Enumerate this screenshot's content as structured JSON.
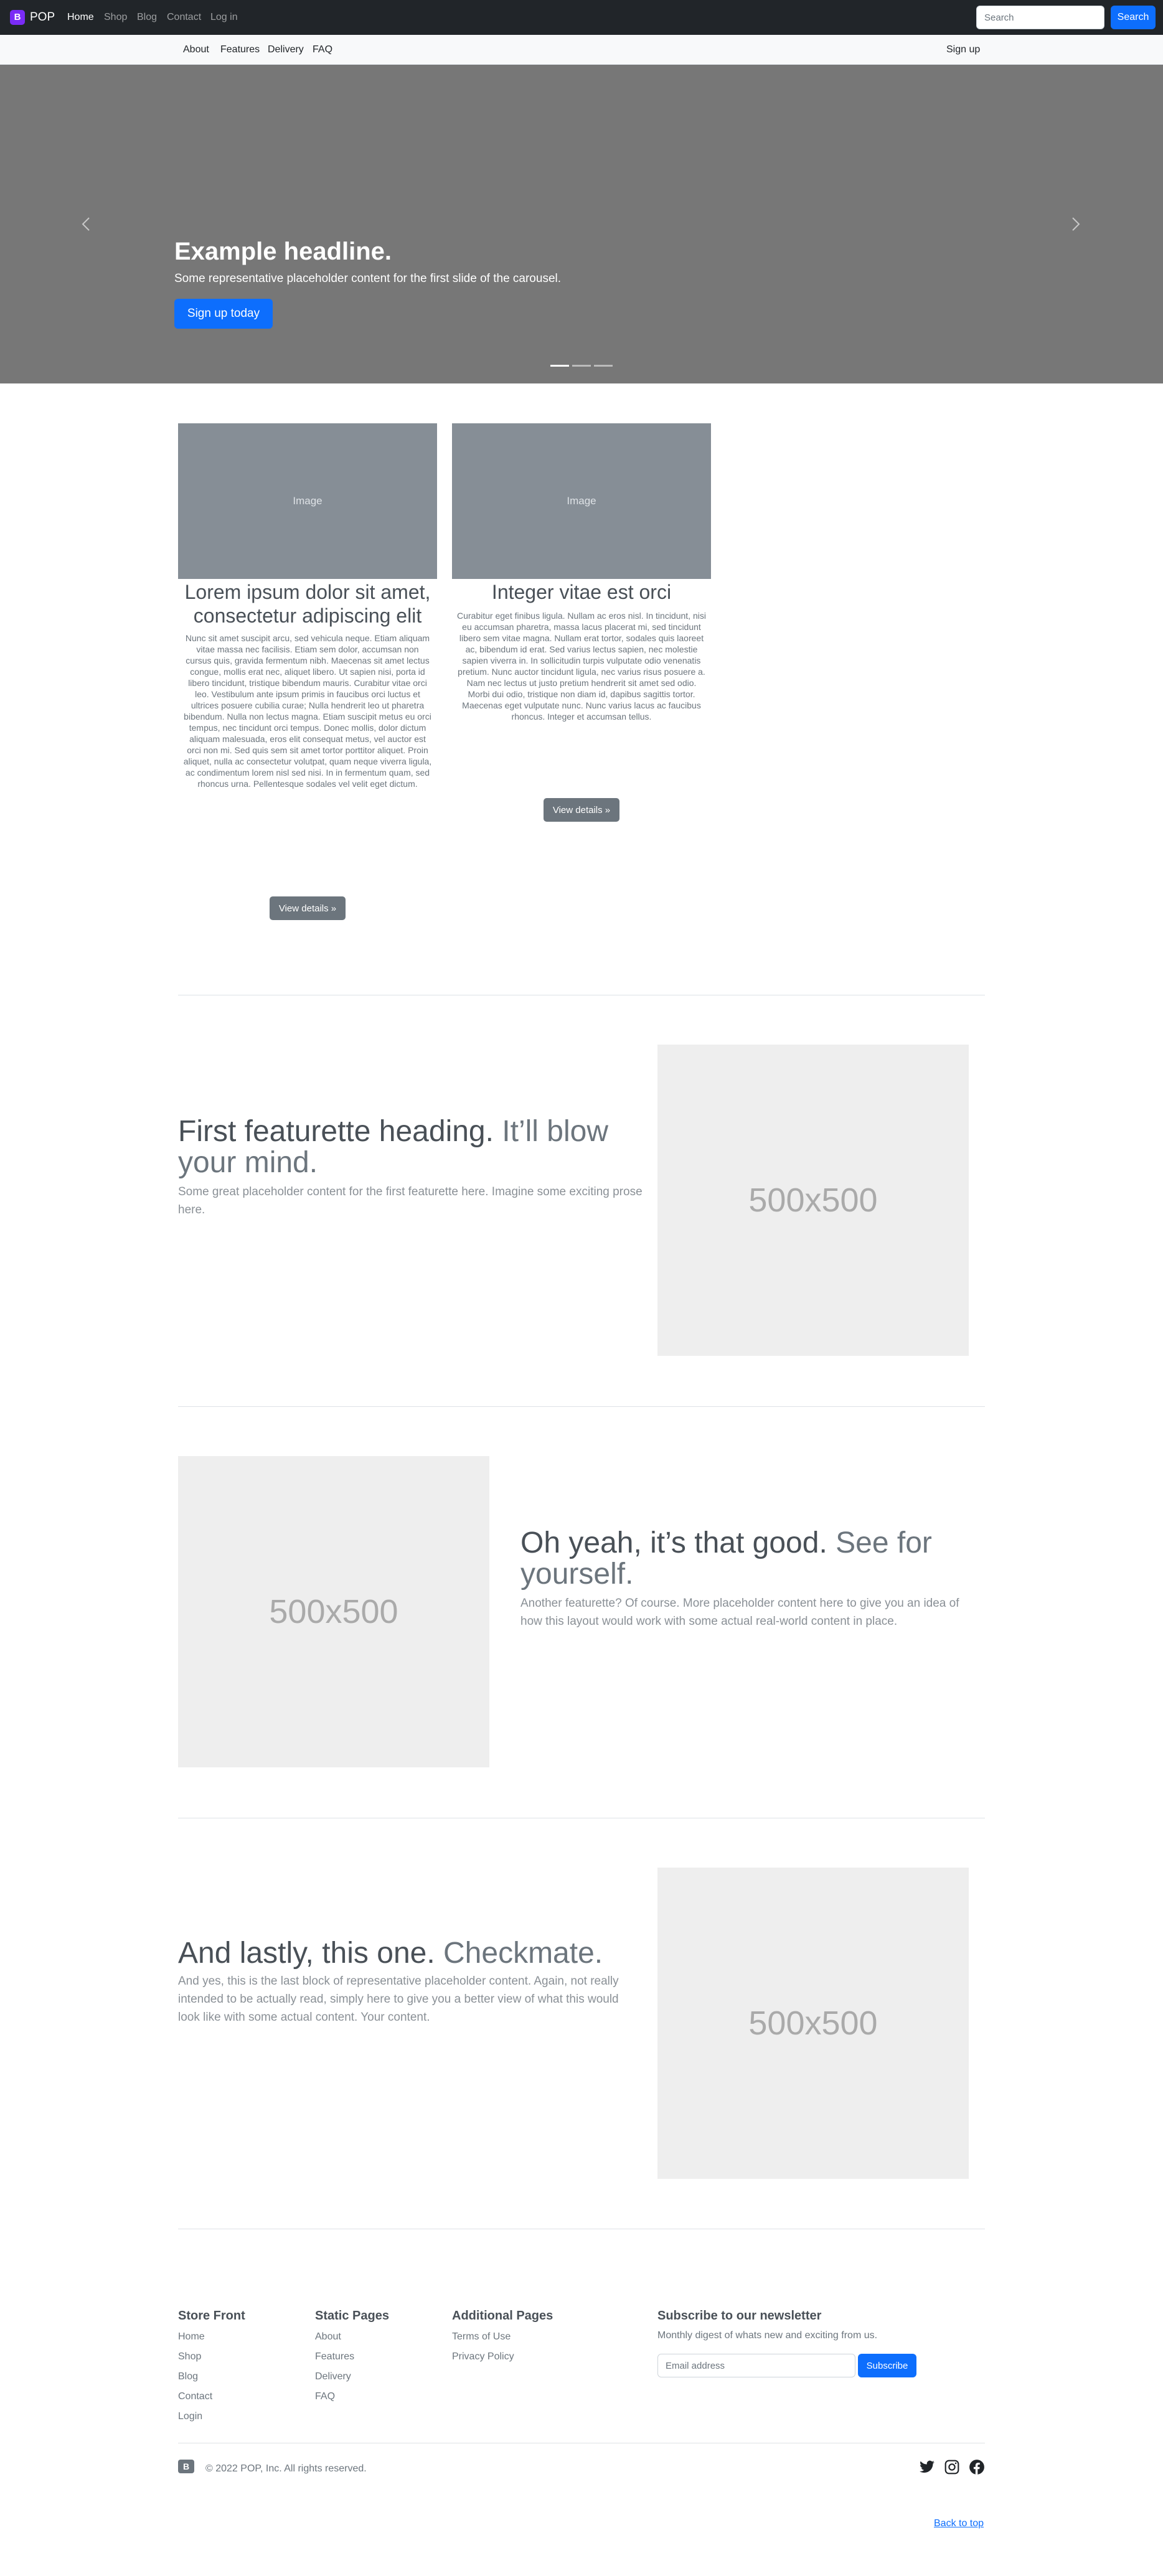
{
  "topnav": {
    "brand": "POP",
    "brand_logo_letter": "B",
    "links": [
      "Home",
      "Shop",
      "Blog",
      "Contact",
      "Log in"
    ],
    "search_placeholder": "Search",
    "search_button": "Search"
  },
  "subnav": {
    "links": [
      "About",
      "Features",
      "Delivery",
      "FAQ"
    ],
    "signup": "Sign up"
  },
  "carousel": {
    "title": "Example headline.",
    "subtitle": "Some representative placeholder content for the first slide of the carousel.",
    "button": "Sign up today",
    "active_slide": 1,
    "slide_count": 3
  },
  "cards": [
    {
      "image_label": "Image",
      "title": "Lorem ipsum dolor sit amet, consectetur adipiscing elit",
      "body": "Nunc sit amet suscipit arcu, sed vehicula neque. Etiam aliquam vitae massa nec facilisis. Etiam sem dolor, accumsan non cursus quis, gravida fermentum nibh. Maecenas sit amet lectus congue, mollis erat nec, aliquet libero. Ut sapien nisi, porta id libero tincidunt, tristique bibendum mauris. Curabitur vitae orci leo. Vestibulum ante ipsum primis in faucibus orci luctus et ultrices posuere cubilia curae; Nulla hendrerit leo ut pharetra bibendum. Nulla non lectus magna. Etiam suscipit metus eu orci tempus, nec tincidunt orci tempus. Donec mollis, dolor dictum aliquam malesuada, eros elit consequat metus, vel auctor est orci non mi. Sed quis sem sit amet tortor porttitor aliquet. Proin aliquet, nulla ac consectetur volutpat, quam neque viverra ligula, ac condimentum lorem nisl sed nisi. In in fermentum quam, sed rhoncus urna. Pellentesque sodales vel velit eget dictum.",
      "button": "View details »"
    },
    {
      "image_label": "Image",
      "title": "Integer vitae est orci",
      "body": "Curabitur eget finibus ligula. Nullam ac eros nisl. In tincidunt, nisi eu accumsan pharetra, massa lacus placerat mi, sed tincidunt libero sem vitae magna. Nullam erat tortor, sodales quis laoreet ac, bibendum id erat. Sed varius lectus sapien, nec molestie sapien viverra in. In sollicitudin turpis vulputate odio venenatis pretium. Nunc auctor tincidunt ligula, nec varius risus posuere a. Nam nec lectus ut justo pretium hendrerit sit amet sed odio. Morbi dui odio, tristique non diam id, dapibus sagittis tortor. Maecenas eget vulputate nunc. Nunc varius lacus ac faucibus rhoncus. Integer et accumsan tellus.",
      "button": "View details »"
    }
  ],
  "featurettes": [
    {
      "heading": "First featurette heading.",
      "heading_muted": "It’ll blow your mind.",
      "lead": "Some great placeholder content for the first featurette here. Imagine some exciting prose here.",
      "placeholder": "500x500"
    },
    {
      "heading": "Oh yeah, it’s that good.",
      "heading_muted": "See for yourself.",
      "lead": "Another featurette? Of course. More placeholder content here to give you an idea of how this layout would work with some actual real-world content in place.",
      "placeholder": "500x500"
    },
    {
      "heading": "And lastly, this one.",
      "heading_muted": "Checkmate.",
      "lead": "And yes, this is the last block of representative placeholder content. Again, not really intended to be actually read, simply here to give you a better view of what this would look like with some actual content. Your content.",
      "placeholder": "500x500"
    }
  ],
  "footer": {
    "columns": [
      {
        "heading": "Store Front",
        "links": [
          "Home",
          "Shop",
          "Blog",
          "Contact",
          "Login"
        ]
      },
      {
        "heading": "Static Pages",
        "links": [
          "About",
          "Features",
          "Delivery",
          "FAQ"
        ]
      },
      {
        "heading": "Additional Pages",
        "links": [
          "Terms of Use",
          "Privacy Policy"
        ]
      }
    ],
    "newsletter": {
      "heading": "Subscribe to our newsletter",
      "text": "Monthly digest of whats new and exciting from us.",
      "email_placeholder": "Email address",
      "button": "Subscribe"
    },
    "logo_letter": "B",
    "copyright": "© 2022 POP, Inc. All rights reserved.",
    "social_icons": [
      "twitter-icon",
      "instagram-icon",
      "facebook-icon"
    ],
    "back_to_top": "Back to top"
  },
  "colors": {
    "brand": "#7a2cf6",
    "primary": "#0d6efd",
    "navbar_bg": "#212529",
    "carousel_bg": "#777777",
    "secondary": "#6c757d"
  }
}
